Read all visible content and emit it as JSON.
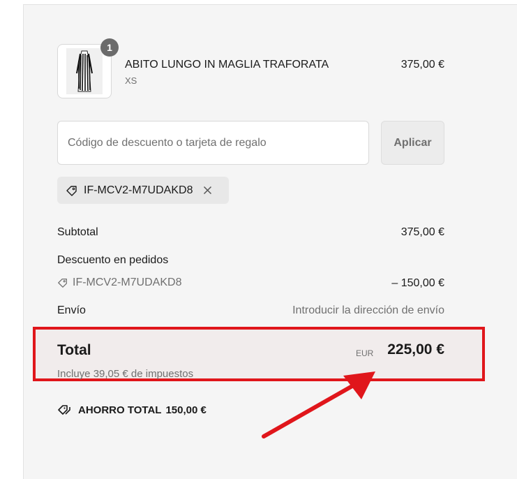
{
  "product": {
    "name": "ABITO LUNGO IN MAGLIA TRAFORATA",
    "variant": "XS",
    "price": "375,00 €",
    "quantity": "1",
    "image_icon": "dress-thumbnail"
  },
  "discount": {
    "placeholder": "Código de descuento o tarjeta de regalo",
    "apply_label": "Aplicar",
    "applied_code": "IF-MCV2-M7UDAKD8"
  },
  "summary": {
    "subtotal_label": "Subtotal",
    "subtotal_value": "375,00 €",
    "order_discount_label": "Descuento en pedidos",
    "order_discount_code": "IF-MCV2-M7UDAKD8",
    "order_discount_value": "– 150,00 €",
    "shipping_label": "Envío",
    "shipping_value": "Introducir la dirección de envío",
    "total_label": "Total",
    "currency": "EUR",
    "total_value": "225,00 €",
    "tax_note": "Incluye 39,05 € de impuestos",
    "savings_label": "AHORRO TOTAL",
    "savings_value": "150,00 €"
  },
  "annotation": {
    "color": "#e0161b"
  }
}
